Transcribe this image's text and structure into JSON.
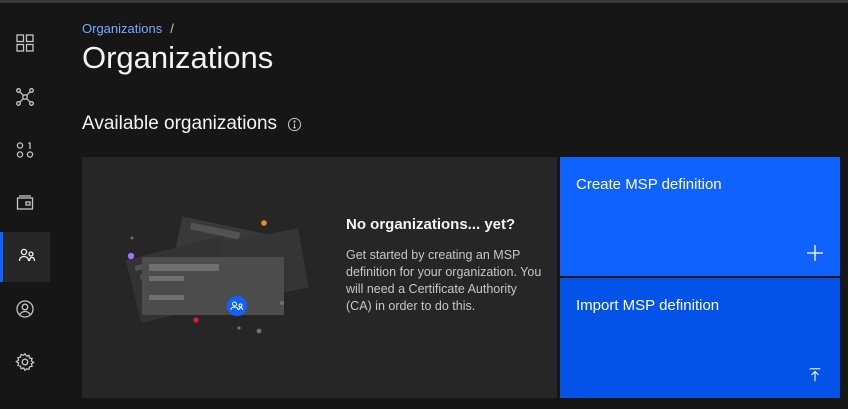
{
  "breadcrumb": {
    "link": "Organizations",
    "separator": "/"
  },
  "page": {
    "title": "Organizations"
  },
  "section": {
    "title": "Available organizations"
  },
  "empty_state": {
    "heading": "No organizations... yet?",
    "body": "Get started by creating an MSP definition for your organization. You will need a Certificate Authority (CA) in order to do this."
  },
  "tiles": {
    "create": {
      "label": "Create MSP definition",
      "icon": "add-icon"
    },
    "import": {
      "label": "Import MSP definition",
      "icon": "upload-icon"
    }
  },
  "sidebar": {
    "items": [
      {
        "icon": "dashboard-icon",
        "active": false
      },
      {
        "icon": "network-icon",
        "active": false
      },
      {
        "icon": "binary-icon",
        "active": false
      },
      {
        "icon": "wallet-icon",
        "active": false
      },
      {
        "icon": "organizations-icon",
        "active": true
      },
      {
        "icon": "user-avatar-icon",
        "active": false
      },
      {
        "icon": "settings-icon",
        "active": false
      }
    ]
  },
  "colors": {
    "accent": "#0f62fe",
    "accent_dark": "#0353e9",
    "link": "#78a9ff",
    "background": "#161616",
    "panel": "#262626"
  }
}
